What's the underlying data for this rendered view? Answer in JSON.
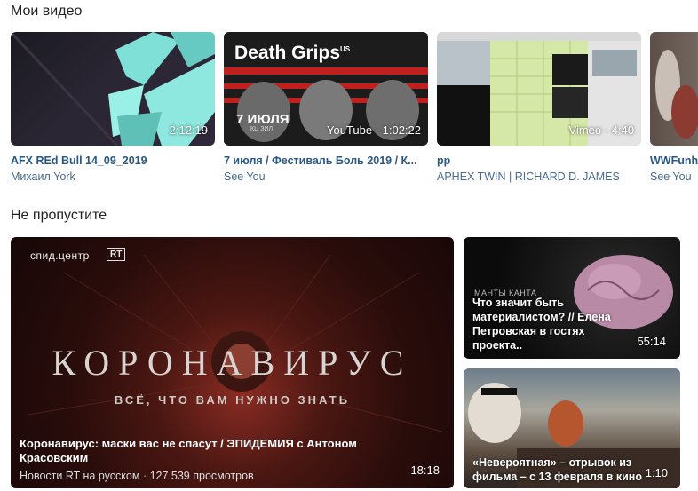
{
  "sections": {
    "my_videos": "Мои видео",
    "dont_miss": "Не пропустите"
  },
  "my_videos": [
    {
      "title": "AFX REd Bull 14_09_2019",
      "author": "Михаил York",
      "duration": "2:12:19",
      "overlay": ""
    },
    {
      "title": "7 июля / Фестиваль Боль 2019 / К...",
      "author": "See You",
      "duration": "YouTube · 1:02:22",
      "overlay": "Death Grips",
      "overlay_sup": "US",
      "overlay_date": "7 ИЮЛЯ",
      "overlay_venue": "КЦ ЗИЛ"
    },
    {
      "title": "pp",
      "author": "APHEX TWIN | RICHARD D. JAMES",
      "duration": "Vimeo · 4:40"
    },
    {
      "title": "WWFunh",
      "author": "See You",
      "duration": ""
    }
  ],
  "featured": {
    "brand": "спид.центр",
    "brand_badge": "RT",
    "headline": "КОРОНАВИРУС",
    "subline": "ВСЁ, ЧТО ВАМ НУЖНО ЗНАТЬ",
    "title": "Коронавирус: маски вас не спасут / ЭПИДЕМИЯ с Антоном Красовским",
    "channel": "Новости RT на русском",
    "views": "127 539 просмотров",
    "duration": "18:18"
  },
  "side_videos": [
    {
      "small": "МАНТЫ КАНТА",
      "title": "Что значит быть материалистом? // Елена Петровская в гостях проекта..",
      "duration": "55:14"
    },
    {
      "title": "«Невероятная» – отрывок из фильма – с 13 февраля в кино",
      "duration": "1:10"
    }
  ]
}
